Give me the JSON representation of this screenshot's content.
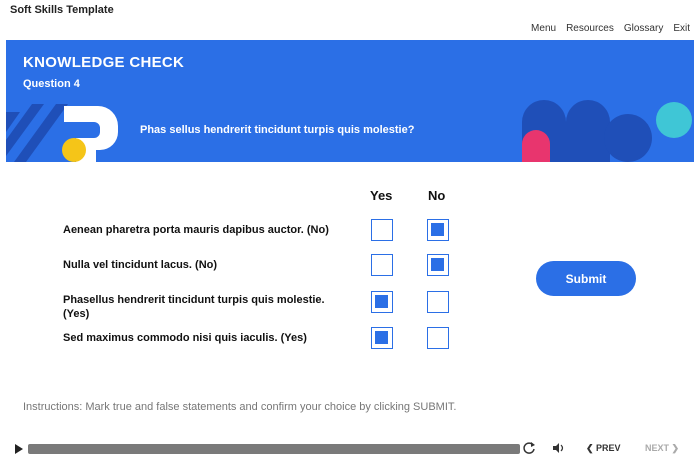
{
  "app": {
    "title": "Soft Skills Template"
  },
  "nav": {
    "menu": "Menu",
    "resources": "Resources",
    "glossary": "Glossary",
    "exit": "Exit"
  },
  "banner": {
    "title": "KNOWLEDGE CHECK",
    "subtitle": "Question 4",
    "question": "Phas sellus hendrerit tincidunt turpis quis molestie?"
  },
  "table": {
    "col_yes": "Yes",
    "col_no": "No",
    "rows": [
      {
        "text": "Aenean pharetra porta mauris dapibus auctor. (No)",
        "yes": false,
        "no": true
      },
      {
        "text": "Nulla vel tincidunt lacus. (No)",
        "yes": false,
        "no": true
      },
      {
        "text": "Phasellus hendrerit tincidunt turpis quis molestie. (Yes)",
        "yes": true,
        "no": false
      },
      {
        "text": "Sed maximus commodo nisi quis iaculis. (Yes)",
        "yes": true,
        "no": false
      }
    ]
  },
  "submit": {
    "label": "Submit"
  },
  "instructions": "Instructions: Mark true and false statements and confirm your choice by clicking SUBMIT.",
  "player": {
    "prev": "❮ PREV",
    "next": "NEXT ❯"
  },
  "colors": {
    "accent": "#2b6fe6",
    "dark_blue": "#1f4fb8",
    "yellow": "#f5c518",
    "pink": "#e8356e",
    "teal": "#3fc6d6"
  }
}
